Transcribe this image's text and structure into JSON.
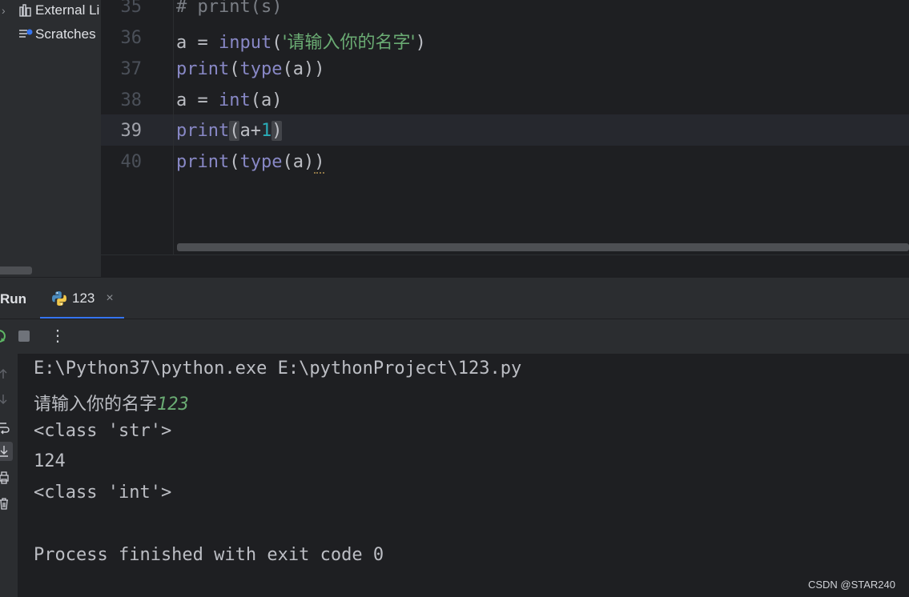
{
  "project_tree": {
    "items": [
      {
        "label": "External Li",
        "icon": "library-icon",
        "expandable": true
      },
      {
        "label": "Scratches",
        "icon": "scratches-icon",
        "expandable": false
      }
    ]
  },
  "editor": {
    "current_line": "39",
    "lines": [
      {
        "number": "35",
        "text": "# print(s)"
      },
      {
        "number": "36",
        "parts": [
          "a = ",
          "input",
          "(",
          "'请输入你的名字'",
          ")"
        ]
      },
      {
        "number": "37",
        "parts": [
          "print",
          "(",
          "type",
          "(a))"
        ]
      },
      {
        "number": "38",
        "parts": [
          "a = ",
          "int",
          "(a)"
        ]
      },
      {
        "number": "39",
        "parts": [
          "print",
          "(",
          "a+",
          "1",
          ")"
        ]
      },
      {
        "number": "40",
        "parts": [
          "print",
          "(",
          "type",
          "(a)",
          ")"
        ]
      }
    ]
  },
  "run_panel": {
    "title": "Run",
    "tab_label": "123",
    "tab_close": "×",
    "more": "⋮"
  },
  "console": {
    "command": "E:\\Python37\\python.exe E:\\pythonProject\\123.py",
    "prompt": "请输入你的名字",
    "user_input": "123",
    "line3": "<class 'str'>",
    "line4": "124",
    "line5": "<class 'int'>",
    "finish": "Process finished with exit code 0"
  },
  "watermark": "CSDN @STAR240",
  "colors": {
    "accent": "#3574f0",
    "string": "#6aab73",
    "builtin": "#8888c6",
    "number": "#2aacb8"
  }
}
